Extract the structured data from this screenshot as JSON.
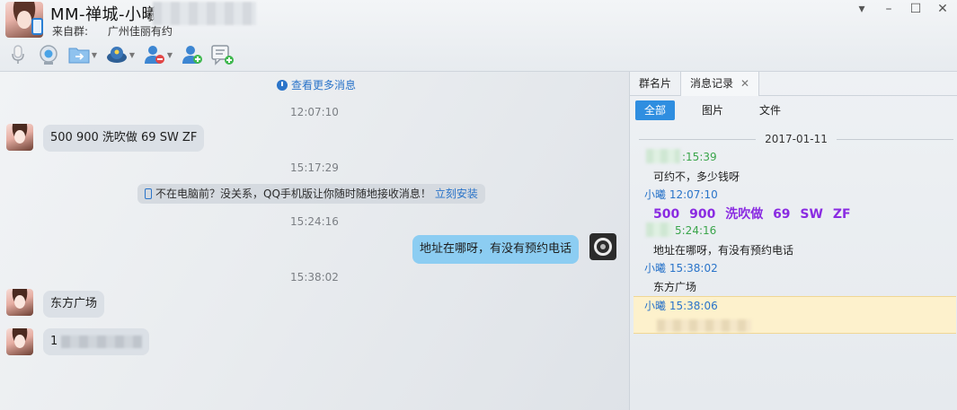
{
  "window": {
    "contact_name": "MM-禅城-小曦",
    "from_group_label": "来自群:",
    "from_group_name": "广州佳丽有约",
    "controls": [
      "▾",
      "–",
      "☐",
      "✕"
    ]
  },
  "toolbar": {
    "icons": [
      "microphone-icon",
      "video-call-icon",
      "send-file-icon",
      "remote-assist-icon",
      "remove-member-icon",
      "add-friend-icon",
      "add-chat-icon"
    ]
  },
  "chat": {
    "more_messages": "查看更多消息",
    "messages": [
      {
        "time": "12:07:10",
        "side": "left",
        "text": "500    900    洗吹做    69    SW   ZF"
      },
      {
        "time": "15:17:29",
        "notice": "不在电脑前？没关系，QQ手机版让你随时随地接收消息！",
        "notice_link": "立刻安装"
      },
      {
        "time": "15:24:16",
        "side": "right",
        "text": "地址在哪呀，有没有预约电话"
      },
      {
        "time": "15:38:02",
        "side": "left",
        "text": "东方广场"
      },
      {
        "side": "left",
        "text": "1"
      }
    ]
  },
  "side": {
    "tabs": [
      "群名片",
      "消息记录"
    ],
    "filters": [
      "全部",
      "图片",
      "文件"
    ],
    "date": "2017-01-11",
    "records": [
      {
        "who": "",
        "time": ":15:39",
        "body": "可约不，多少钱呀"
      },
      {
        "who": "小曦",
        "time": "12:07:10",
        "body": "500    900    洗吹做    69    SW   ZF"
      },
      {
        "who": "",
        "time": "5:24:16",
        "body": "地址在哪呀，有没有预约电话"
      },
      {
        "who": "小曦",
        "time": "15:38:02",
        "body": "东方广场"
      },
      {
        "who": "小曦",
        "time": "15:38:06",
        "body": ""
      }
    ]
  },
  "colors": {
    "accent": "#2f8ee0",
    "self_bubble": "#8ccdf2",
    "other_bubble": "#dbe0e6",
    "record_name_blue": "#2a74c9",
    "record_name_green": "#3aa54b",
    "highlight": "#fdf1cc"
  }
}
